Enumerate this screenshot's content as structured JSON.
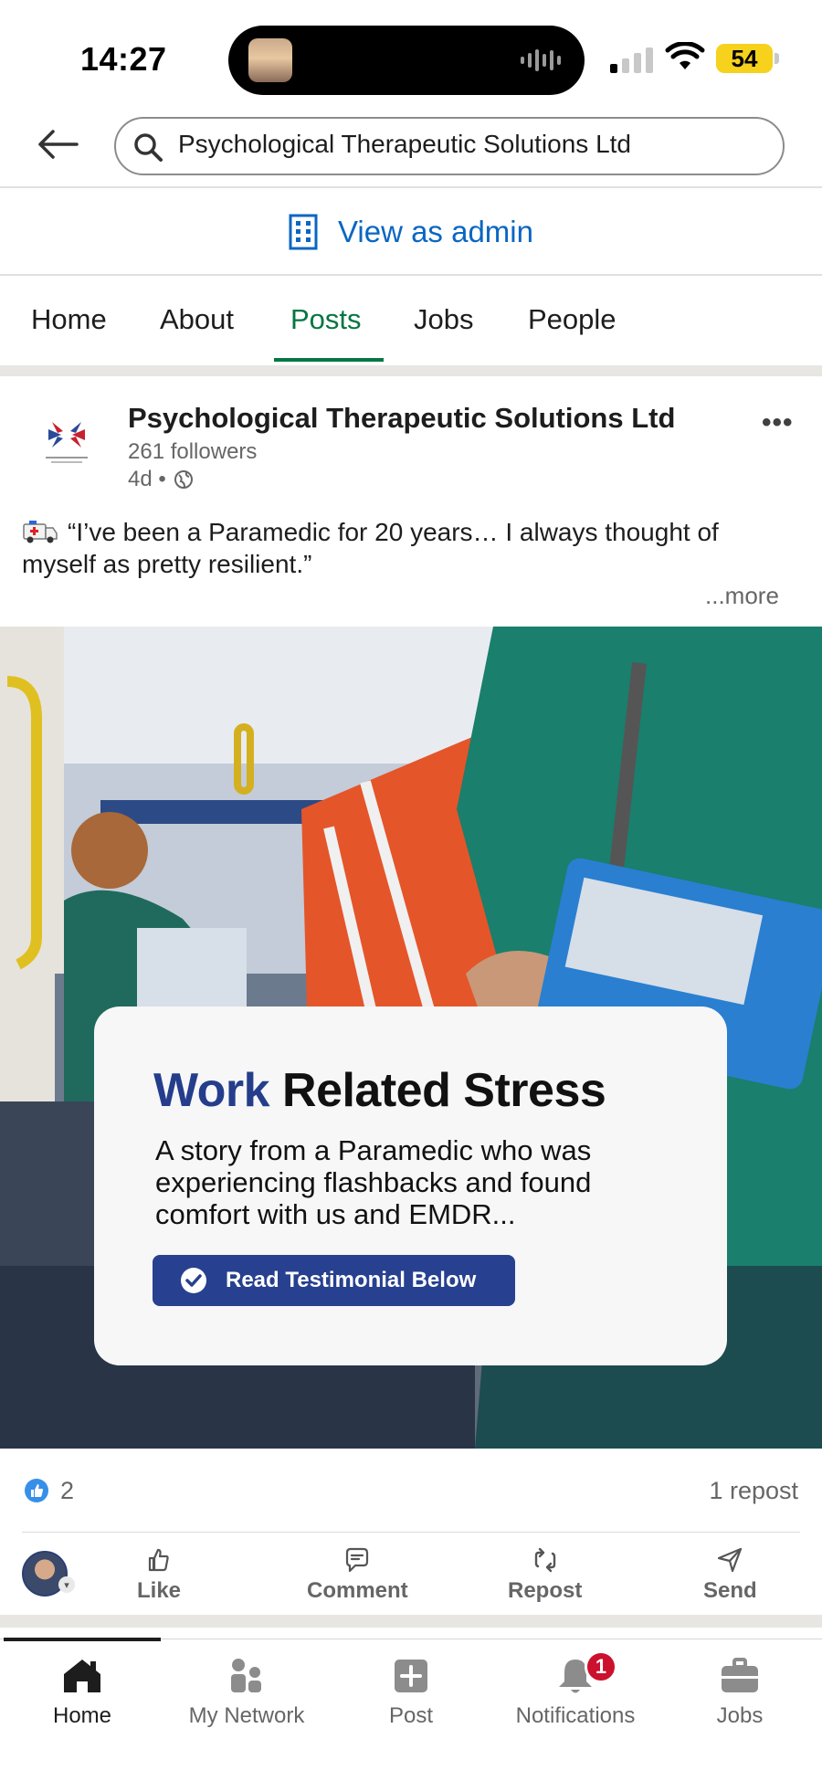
{
  "status_bar": {
    "time": "14:27",
    "battery": "54"
  },
  "search": {
    "value": "Psychological Therapeutic Solutions Ltd"
  },
  "admin": {
    "label": "View as admin"
  },
  "tabs": [
    {
      "label": "Home"
    },
    {
      "label": "About"
    },
    {
      "label": "Posts",
      "active": true
    },
    {
      "label": "Jobs"
    },
    {
      "label": "People"
    }
  ],
  "post": {
    "author": "Psychological Therapeutic Solutions Ltd",
    "followers": "261 followers",
    "age": "4d •",
    "text": "“I’ve been a Paramedic for 20 years… I always thought of myself as pretty resilient.”",
    "see_more": "...more",
    "image_card": {
      "title_accent": "Work",
      "title_rest": " Related Stress",
      "body": "A story from a Paramedic who was experiencing flashbacks and found comfort with us and EMDR...",
      "button": "Read Testimonial Below"
    },
    "likes": "2",
    "reposts": "1 repost"
  },
  "actions": [
    {
      "label": "Like"
    },
    {
      "label": "Comment"
    },
    {
      "label": "Repost"
    },
    {
      "label": "Send"
    }
  ],
  "bottom_nav": [
    {
      "label": "Home",
      "active": true
    },
    {
      "label": "My Network"
    },
    {
      "label": "Post"
    },
    {
      "label": "Notifications",
      "badge": "1"
    },
    {
      "label": "Jobs"
    }
  ],
  "colors": {
    "linkedin_blue": "#0a66c2",
    "tab_active": "#057642",
    "card_accent": "#243e8c",
    "card_button": "#27408f"
  }
}
